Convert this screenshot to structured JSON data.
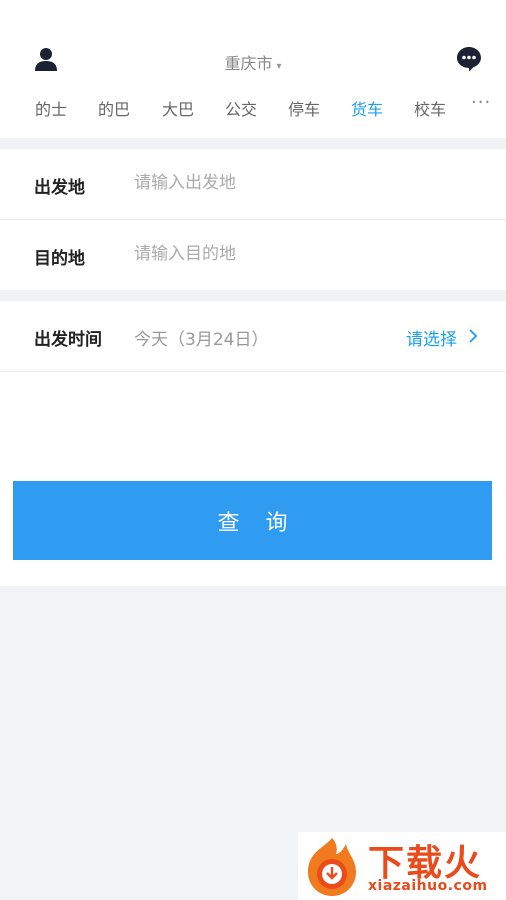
{
  "header": {
    "city": "重庆市",
    "city_caret": "▾",
    "user_icon": "user-icon",
    "message_icon": "message-bubble-icon"
  },
  "tabs": {
    "items": [
      {
        "label": "的士"
      },
      {
        "label": "的巴"
      },
      {
        "label": "大巴"
      },
      {
        "label": "公交"
      },
      {
        "label": "停车"
      },
      {
        "label": "货车",
        "active": true
      },
      {
        "label": "校车"
      }
    ],
    "more": "···"
  },
  "form": {
    "origin_label": "出发地",
    "origin_placeholder": "请输入出发地",
    "destination_label": "目的地",
    "destination_placeholder": "请输入目的地"
  },
  "time": {
    "label": "出发时间",
    "value": "今天（3月24日）",
    "choose": "请选择"
  },
  "query_button": "查询",
  "watermark": {
    "title": "下载火",
    "url": "xiazaihuo.com"
  },
  "colors": {
    "accent": "#1a9ff2",
    "button": "#2f9bf1",
    "watermark": "#e94b1b"
  }
}
